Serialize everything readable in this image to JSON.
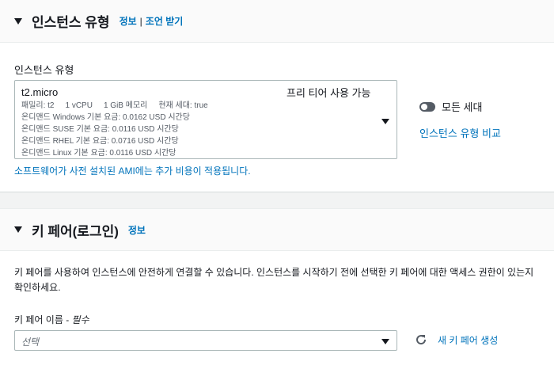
{
  "instance_section": {
    "title": "인스턴스 유형",
    "info_link": "정보",
    "separator": "|",
    "advice_link": "조언 받기",
    "field_label": "인스턴스 유형",
    "selected": {
      "name": "t2.micro",
      "badge": "프리 티어 사용 가능",
      "specs": {
        "family": "패밀리: t2",
        "vcpu": "1 vCPU",
        "memory": "1 GiB 메모리",
        "generation": "현재 세대: true"
      },
      "pricing": [
        "온디맨드 Windows 기본 요금: 0.0162 USD 시간당",
        "온디맨드 SUSE 기본 요금: 0.0116 USD 시간당",
        "온디맨드 RHEL 기본 요금: 0.0716 USD 시간당",
        "온디맨드 Linux 기본 요금: 0.0116 USD 시간당"
      ]
    },
    "helper_text": "소프트웨어가 사전 설치된 AMI에는 추가 비용이 적용됩니다.",
    "toggle_label": "모든 세대",
    "compare_link": "인스턴스 유형 비교"
  },
  "keypair_section": {
    "title": "키 페어(로그인)",
    "info_link": "정보",
    "description": "키 페어를 사용하여 인스턴스에 안전하게 연결할 수 있습니다. 인스턴스를 시작하기 전에 선택한 키 페어에 대한 액세스 권한이 있는지 확인하세요.",
    "field_label": "키 페어 이름 - ",
    "required": "필수",
    "placeholder": "선택",
    "create_link": "새 키 페어 생성"
  },
  "colors": {
    "link": "#0073bb",
    "text": "#16191f",
    "header_bg": "#fafafa",
    "border": "#aab7b8"
  },
  "icons": {
    "section_toggle": "caret-down-icon",
    "dropdown": "triangle-down-icon",
    "refresh": "refresh-icon"
  }
}
